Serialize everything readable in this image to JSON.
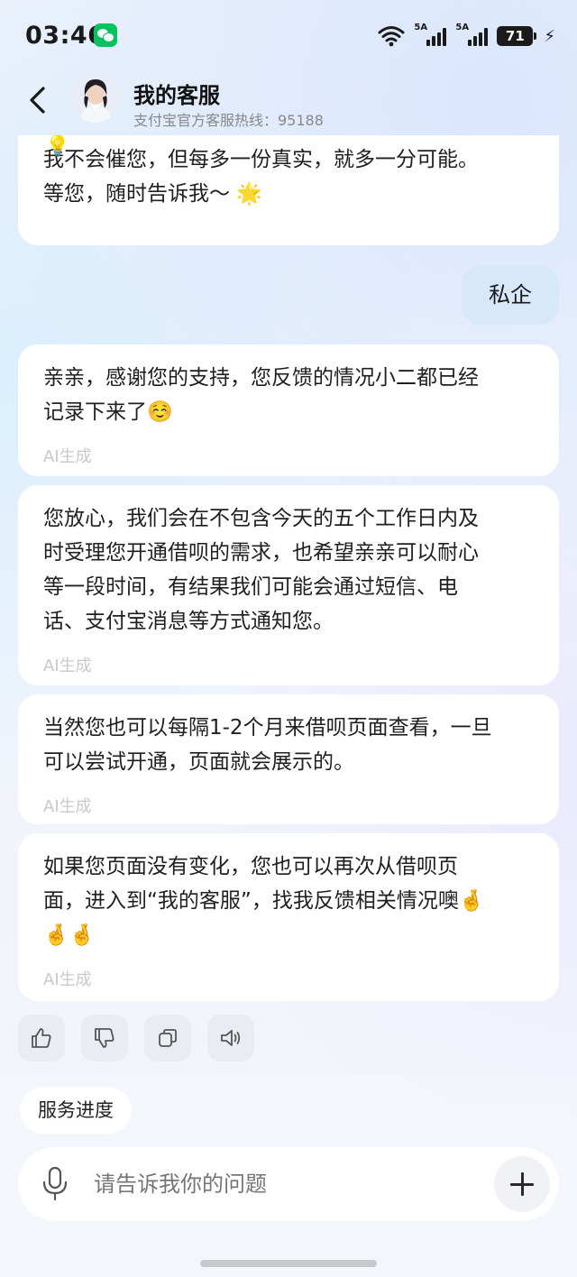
{
  "status_bar": {
    "time": "03:46",
    "signal1_label": "5A",
    "signal2_label": "5A",
    "battery": "71"
  },
  "header": {
    "title": "我的客服",
    "subtitle": "支付宝官方客服热线：95188"
  },
  "messages": [
    {
      "role": "assistant",
      "lines": [
        "我不会催您，但每多一份真实，就多一分可能。",
        "等您，随时告诉我～ 🌟"
      ],
      "ai_tag": ""
    },
    {
      "role": "user",
      "text": "私企"
    },
    {
      "role": "assistant",
      "lines": [
        "亲亲，感谢您的支持，您反馈的情况小二都已经",
        "记录下来了☺️"
      ],
      "ai_tag": "AI生成"
    },
    {
      "role": "assistant",
      "lines": [
        "您放心，我们会在不包含今天的五个工作日内及",
        "时受理您开通借呗的需求，也希望亲亲可以耐心",
        "等一段时间，有结果我们可能会通过短信、电",
        "话、支付宝消息等方式通知您。"
      ],
      "ai_tag": "AI生成"
    },
    {
      "role": "assistant",
      "lines": [
        "当然您也可以每隔1-2个月来借呗页面查看，一旦",
        "可以尝试开通，页面就会展示的。"
      ],
      "ai_tag": "AI生成"
    },
    {
      "role": "assistant",
      "lines": [
        "如果您页面没有变化，您也可以再次从借呗页",
        "面，进入到“我的客服”，找我反馈相关情况噢🤞",
        "🤞🤞"
      ],
      "ai_tag": "AI生成"
    }
  ],
  "actions": [
    "thumbs-up-icon",
    "thumbs-down-icon",
    "copy-icon",
    "speaker-icon"
  ],
  "quick_chip": "服务进度",
  "input": {
    "placeholder": "请告诉我你的问题"
  }
}
